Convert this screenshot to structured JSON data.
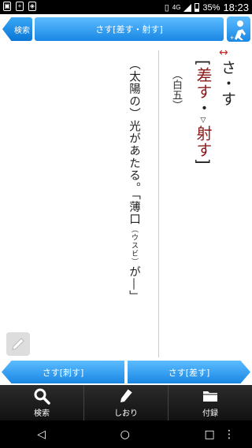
{
  "status": {
    "battery": "35%",
    "time": "18:23",
    "network": "4G"
  },
  "toolbar": {
    "search_label": "検索",
    "title": "さす[差す・射す]"
  },
  "entry": {
    "arrow": "↔",
    "reading": "さ・す",
    "bracket_open": "[",
    "kanji_1": "差す",
    "dot": "・",
    "sup_mark": "▽",
    "kanji_2": "射す",
    "bracket_close": "]",
    "tag": "（白五）",
    "meaning_1": "（太陽の）光があたる。「薄口",
    "meaning_ruby": "（ウスビ）",
    "meaning_2": "が―」"
  },
  "nav": {
    "prev": "さす[刺す]",
    "next": "さす[差す]"
  },
  "tabs": [
    {
      "label": "検索",
      "icon": "search-icon"
    },
    {
      "label": "しおり",
      "icon": "bookmark-pen-icon"
    },
    {
      "label": "付録",
      "icon": "folder-icon"
    }
  ]
}
